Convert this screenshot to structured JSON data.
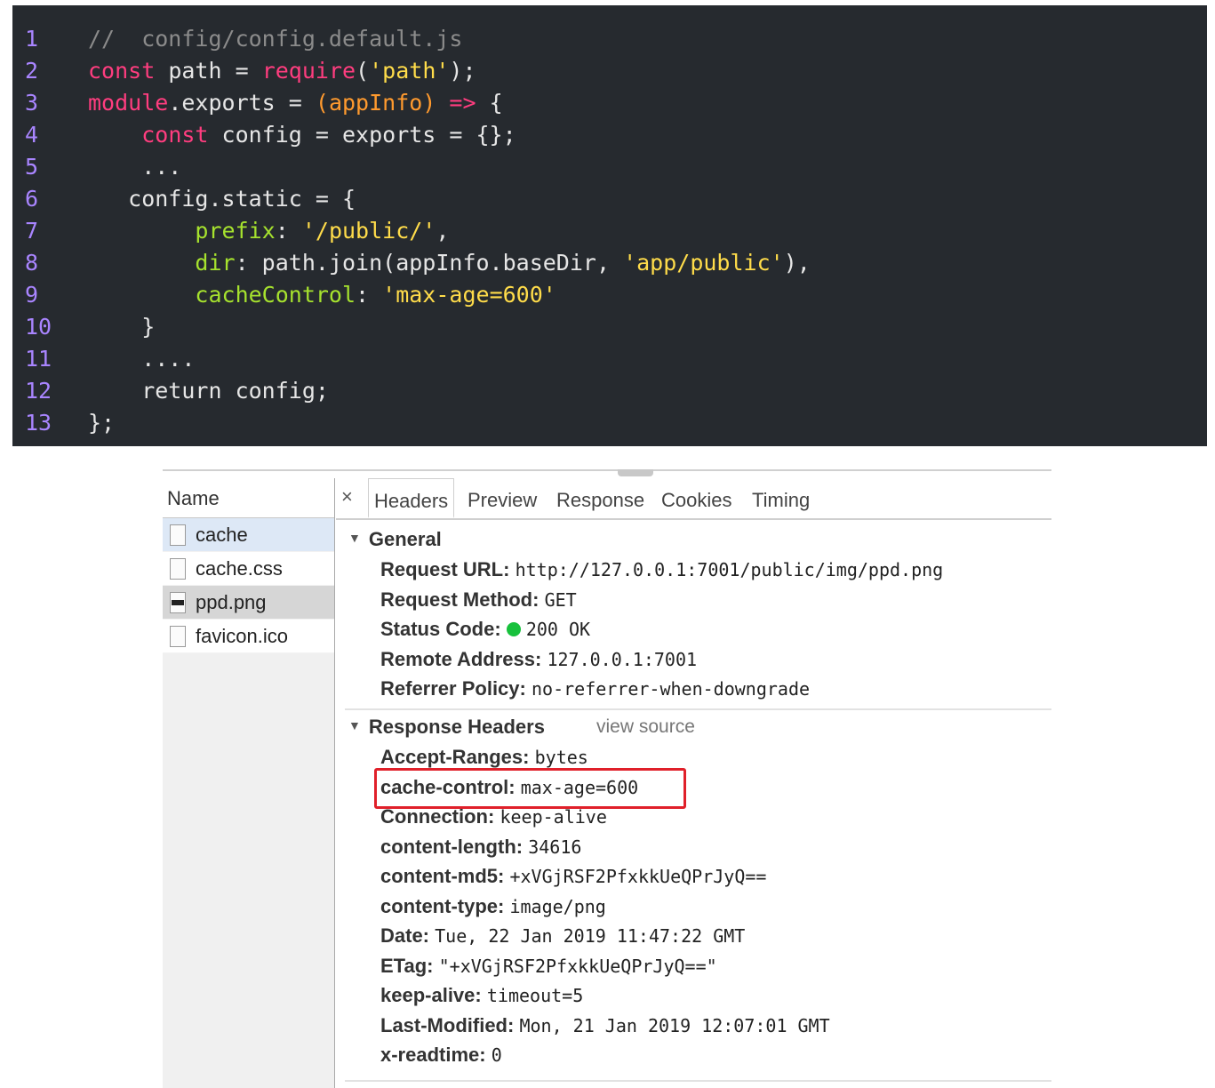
{
  "code": {
    "lines": [
      {
        "n": "1",
        "parts": [
          {
            "t": "//  config/config.default.js",
            "c": "c-com"
          }
        ]
      },
      {
        "n": "2",
        "parts": [
          {
            "t": "const",
            "c": "c-kw"
          },
          {
            "t": " path = ",
            "c": ""
          },
          {
            "t": "require",
            "c": "c-kw"
          },
          {
            "t": "(",
            "c": ""
          },
          {
            "t": "'path'",
            "c": "c-str"
          },
          {
            "t": ");",
            "c": ""
          }
        ]
      },
      {
        "n": "3",
        "parts": [
          {
            "t": "module",
            "c": "c-kw"
          },
          {
            "t": ".exports = ",
            "c": ""
          },
          {
            "t": "(appInfo)",
            "c": "c-par"
          },
          {
            "t": " ",
            "c": ""
          },
          {
            "t": "=>",
            "c": "c-kw"
          },
          {
            "t": " {",
            "c": ""
          }
        ]
      },
      {
        "n": "4",
        "parts": [
          {
            "t": "    ",
            "c": ""
          },
          {
            "t": "const",
            "c": "c-kw"
          },
          {
            "t": " config = exports = {};",
            "c": ""
          }
        ]
      },
      {
        "n": "5",
        "parts": [
          {
            "t": "    ...",
            "c": ""
          }
        ]
      },
      {
        "n": "6",
        "parts": [
          {
            "t": "   config.static = {",
            "c": ""
          }
        ]
      },
      {
        "n": "7",
        "parts": [
          {
            "t": "        ",
            "c": ""
          },
          {
            "t": "prefix",
            "c": "c-prop"
          },
          {
            "t": ": ",
            "c": ""
          },
          {
            "t": "'/public/'",
            "c": "c-str"
          },
          {
            "t": ",",
            "c": ""
          }
        ]
      },
      {
        "n": "8",
        "parts": [
          {
            "t": "        ",
            "c": ""
          },
          {
            "t": "dir",
            "c": "c-prop"
          },
          {
            "t": ": path.join(appInfo.baseDir, ",
            "c": ""
          },
          {
            "t": "'app/public'",
            "c": "c-str"
          },
          {
            "t": "),",
            "c": ""
          }
        ]
      },
      {
        "n": "9",
        "parts": [
          {
            "t": "        ",
            "c": ""
          },
          {
            "t": "cacheControl",
            "c": "c-prop"
          },
          {
            "t": ": ",
            "c": ""
          },
          {
            "t": "'max-age=600'",
            "c": "c-str"
          }
        ]
      },
      {
        "n": "10",
        "parts": [
          {
            "t": "    }",
            "c": ""
          }
        ]
      },
      {
        "n": "11",
        "parts": [
          {
            "t": "    ....",
            "c": ""
          }
        ]
      },
      {
        "n": "12",
        "parts": [
          {
            "t": "    return config;",
            "c": ""
          }
        ]
      },
      {
        "n": "13",
        "parts": [
          {
            "t": "};",
            "c": ""
          }
        ]
      }
    ]
  },
  "devtools": {
    "name_header": "Name",
    "files": [
      {
        "name": "cache",
        "state": "active",
        "icon": "file-icon"
      },
      {
        "name": "cache.css",
        "state": "",
        "icon": "file-icon"
      },
      {
        "name": "ppd.png",
        "state": "selected",
        "icon": "image-file-icon"
      },
      {
        "name": "favicon.ico",
        "state": "",
        "icon": "file-icon"
      }
    ],
    "close_symbol": "×",
    "tabs": [
      "Headers",
      "Preview",
      "Response",
      "Cookies",
      "Timing"
    ],
    "general": {
      "title": "General",
      "rows": [
        {
          "k": "Request URL:",
          "v": "http://127.0.0.1:7001/public/img/ppd.png"
        },
        {
          "k": "Request Method:",
          "v": "GET"
        },
        {
          "k": "Status Code:",
          "v": "200 OK"
        },
        {
          "k": "Remote Address:",
          "v": "127.0.0.1:7001"
        },
        {
          "k": "Referrer Policy:",
          "v": "no-referrer-when-downgrade"
        }
      ]
    },
    "response_headers": {
      "title": "Response Headers",
      "view_source": "view source",
      "rows": [
        {
          "k": "Accept-Ranges:",
          "v": "bytes"
        },
        {
          "k": "cache-control:",
          "v": "max-age=600"
        },
        {
          "k": "Connection:",
          "v": "keep-alive"
        },
        {
          "k": "content-length:",
          "v": "34616"
        },
        {
          "k": "content-md5:",
          "v": "+xVGjRSF2PfxkkUeQPrJyQ=="
        },
        {
          "k": "content-type:",
          "v": "image/png"
        },
        {
          "k": "Date:",
          "v": "Tue, 22 Jan 2019 11:47:22 GMT"
        },
        {
          "k": "ETag:",
          "v": "\"+xVGjRSF2PfxkkUeQPrJyQ==\""
        },
        {
          "k": "keep-alive:",
          "v": "timeout=5"
        },
        {
          "k": "Last-Modified:",
          "v": "Mon, 21 Jan 2019 12:07:01 GMT"
        },
        {
          "k": "x-readtime:",
          "v": "0"
        }
      ]
    },
    "colors": {
      "highlight": "#e0202a",
      "status_ok": "#17c13c"
    }
  }
}
